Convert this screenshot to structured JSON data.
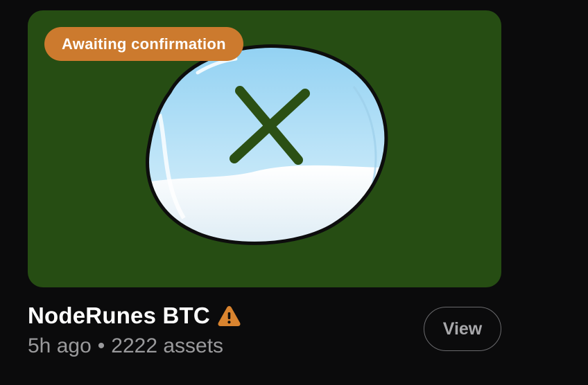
{
  "card": {
    "status_badge": "Awaiting confirmation",
    "title": "NodeRunes BTC",
    "time_ago": "5h ago",
    "separator": "•",
    "asset_count": "2222 assets",
    "view_label": "View",
    "warning_icon": "warning-triangle-icon",
    "image_icon": "x-bubble-icon"
  },
  "colors": {
    "background": "#0b0b0c",
    "image_background": "#264d13",
    "badge": "#cc7a2e",
    "warning": "#d9842f",
    "x_mark": "#2b5014"
  }
}
